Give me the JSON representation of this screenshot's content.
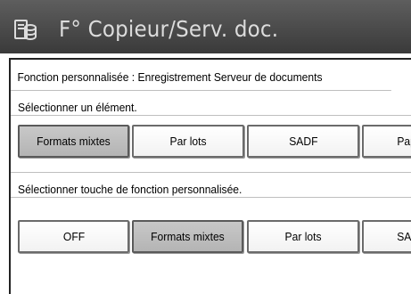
{
  "title_bar": {
    "title": "F° Copieur/Serv. doc.",
    "icon": "copier-server-icon"
  },
  "header": {
    "text": "Fonction personnalisée : Enregistrement Serveur de documents"
  },
  "section_item": {
    "label": "Sélectionner un élément.",
    "buttons": [
      {
        "label": "Formats mixtes",
        "selected": true
      },
      {
        "label": "Par lots",
        "selected": false
      },
      {
        "label": "SADF",
        "selected": false
      },
      {
        "label": "Papier",
        "selected": false
      }
    ]
  },
  "section_key": {
    "label": "Sélectionner touche de fonction personnalisée.",
    "buttons": [
      {
        "label": "OFF",
        "selected": false
      },
      {
        "label": "Formats mixtes",
        "selected": true
      },
      {
        "label": "Par lots",
        "selected": false
      },
      {
        "label": "SADF",
        "selected": false
      }
    ]
  },
  "colors": {
    "title_bg": "#4a4a4a",
    "title_text": "#dcdcdc",
    "selected_button": "#bdbdbd"
  }
}
